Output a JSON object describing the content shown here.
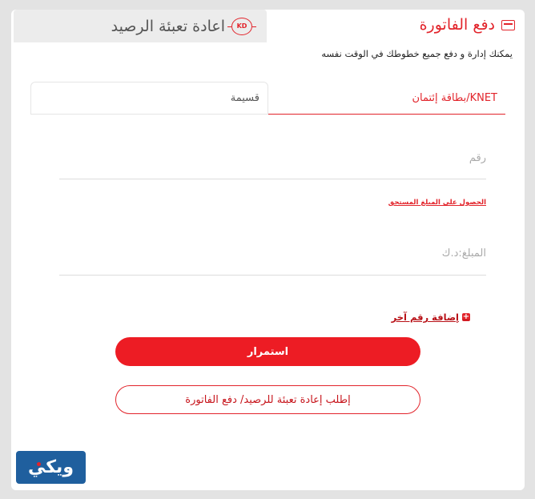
{
  "tabs": {
    "pay_bill": {
      "label": "دفع الفاتورة",
      "icon": "wallet-icon"
    },
    "recharge": {
      "label": "اعادة تعبئة الرصيد",
      "icon": "kd-icon",
      "icon_text": "KD"
    }
  },
  "subtitle": "يمكنك إدارة و دفع جميع خطوطك في الوقت نفسه",
  "payment_methods": {
    "knet": "KNET/بطاقة إئتمان",
    "installment": "قسيمة"
  },
  "form": {
    "number_placeholder": "رقم",
    "due_amount_link": "الحصول على المبلغ المستحق",
    "amount_placeholder": "المبلغ:د.ك",
    "add_number_link": "إضافة رقم آخر",
    "continue_button": "استمرار",
    "request_button": "إطلب إعادة تعبئة للرصيد/ دفع الفاتورة"
  },
  "logo": {
    "text": "ويكي"
  },
  "colors": {
    "accent": "#e2242b",
    "button": "#ed1c24",
    "logo_bg": "#1f5f9e",
    "background": "#e3e3e3"
  }
}
